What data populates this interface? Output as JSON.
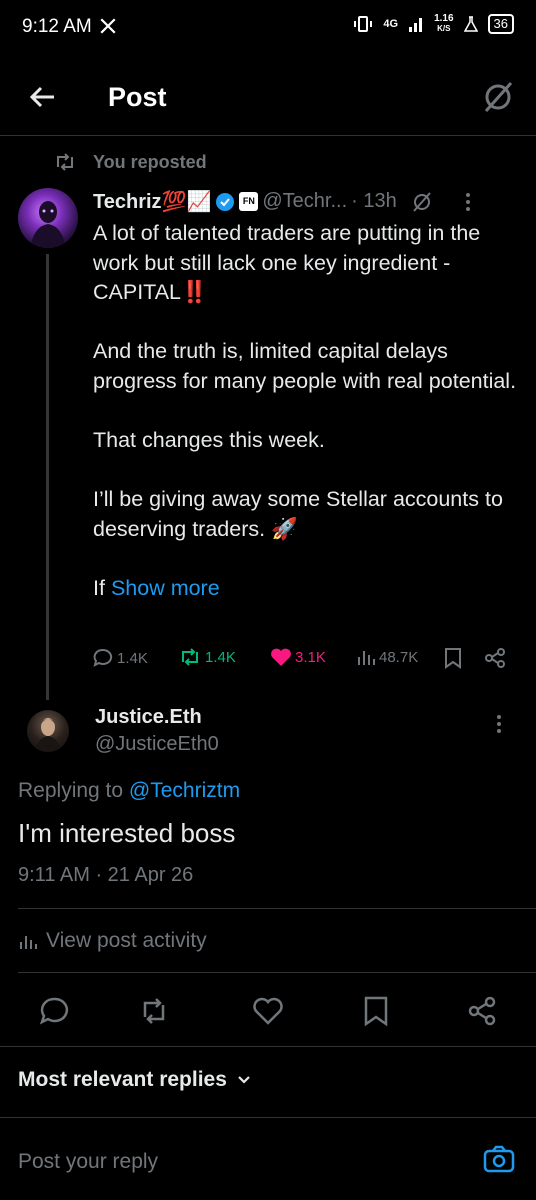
{
  "status_bar": {
    "time": "9:12 AM",
    "network": "4G",
    "speed": "1.16",
    "speed_unit": "K/S",
    "battery": "36"
  },
  "header": {
    "title": "Post"
  },
  "repost": {
    "text": "You reposted"
  },
  "original_post": {
    "author": "Techriz💯📈",
    "handle": "@Techr...",
    "time": "· 13h",
    "badge_text": "FN",
    "body": [
      "A lot of talented traders are putting in the work but still lack one key ingredient - CAPITAL‼️",
      "And the truth is, limited capital delays progress for many people with real potential.",
      "That changes this week.",
      "I’ll be giving away some Stellar accounts to deserving traders. 🚀"
    ],
    "truncated_prefix": "If",
    "show_more": "Show more",
    "replies": "1.4K",
    "reposts": "1.4K",
    "likes": "3.1K",
    "views": "48.7K"
  },
  "reply": {
    "author": "Justice.Eth",
    "handle": "@JusticeEth0",
    "replying_prefix": "Replying to",
    "replying_handle": "@Techriztm",
    "text": "I'm interested boss",
    "timestamp": "9:11 AM · 21 Apr 26"
  },
  "activity_link": "View post activity",
  "sort_label": "Most relevant replies",
  "compose": {
    "placeholder": "Post your reply"
  },
  "colors": {
    "background": "#000000",
    "text": "#e7e9ea",
    "secondary": "#71767b",
    "link": "#1d9bf0",
    "repost_green": "#00ba7c",
    "like_pink": "#f91880",
    "divider": "#2f3336"
  }
}
